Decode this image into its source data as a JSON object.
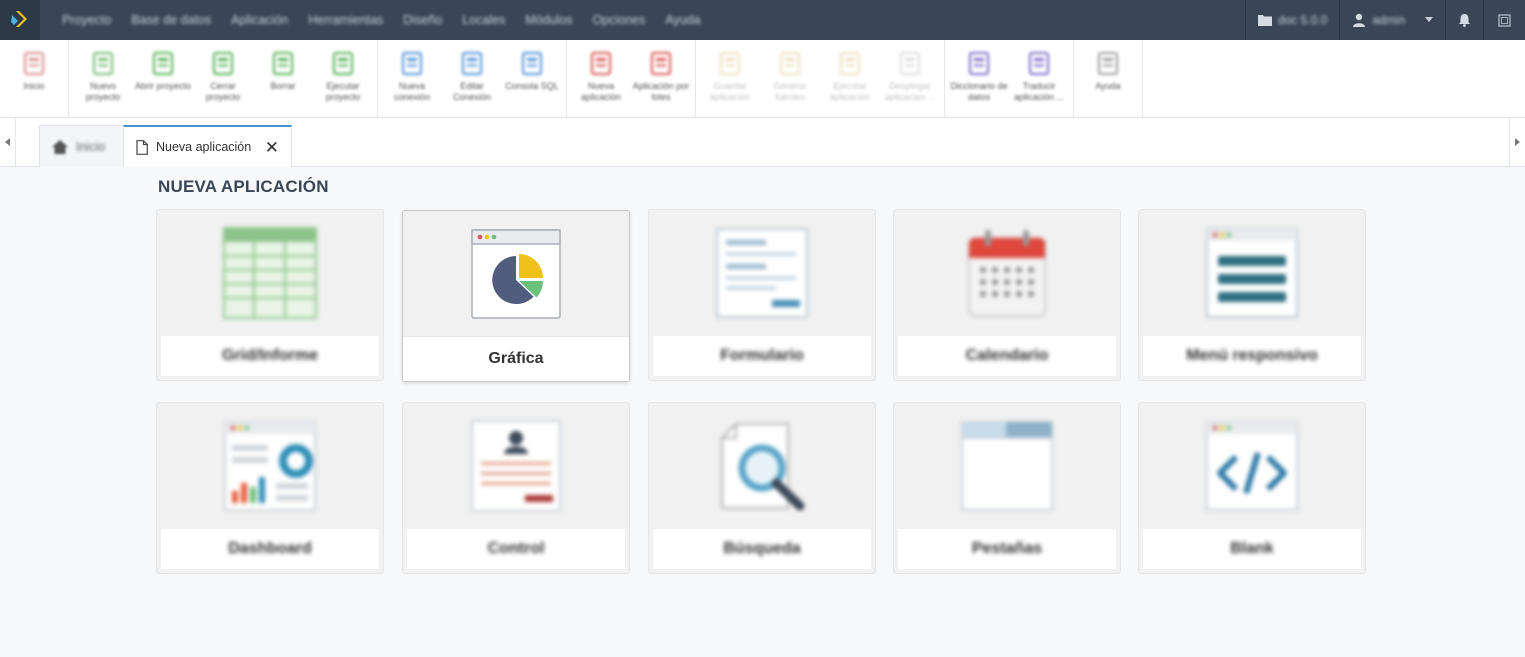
{
  "menubar": {
    "items": [
      "Proyecto",
      "Base de datos",
      "Aplicación",
      "Herramientas",
      "Diseño",
      "Locales",
      "Módulos",
      "Opciones",
      "Ayuda"
    ],
    "project": "doc 5.0.0",
    "user": "admin"
  },
  "toolbar": {
    "groups": [
      [
        {
          "label": "Inicio",
          "icon": "home-icon",
          "color": "#d98a8a"
        }
      ],
      [
        {
          "label": "Nuevo proyecto",
          "icon": "new-project-icon",
          "color": "#6db86d"
        },
        {
          "label": "Abrir proyecto",
          "icon": "open-project-icon",
          "color": "#4fae4f"
        },
        {
          "label": "Cerrar proyecto",
          "icon": "close-project-icon",
          "color": "#4fae4f"
        },
        {
          "label": "Borrar",
          "icon": "delete-icon",
          "color": "#4fae4f"
        },
        {
          "label": "Ejecutar proyecto",
          "icon": "run-project-icon",
          "color": "#4fae4f"
        }
      ],
      [
        {
          "label": "Nueva conexión",
          "icon": "new-connection-icon",
          "color": "#4a90d9"
        },
        {
          "label": "Editar Conexión",
          "icon": "edit-connection-icon",
          "color": "#4a90d9"
        },
        {
          "label": "Consola SQL",
          "icon": "sql-console-icon",
          "color": "#4a90d9"
        }
      ],
      [
        {
          "label": "Nueva aplicación",
          "icon": "new-app-icon",
          "color": "#d9534f"
        },
        {
          "label": "Aplicación por lotes",
          "icon": "batch-app-icon",
          "color": "#d9534f"
        }
      ],
      [
        {
          "label": "Guardar aplicación",
          "icon": "save-app-icon",
          "color": "#c9a640",
          "disabled": true
        },
        {
          "label": "Generar fuentes",
          "icon": "generate-source-icon",
          "color": "#c9a640",
          "disabled": true
        },
        {
          "label": "Ejecutar aplicación",
          "icon": "run-app-icon",
          "color": "#c9a640",
          "disabled": true
        },
        {
          "label": "Desplegar aplicación ...",
          "icon": "deploy-app-icon",
          "color": "#999999",
          "disabled": true
        }
      ],
      [
        {
          "label": "Diccionario de datos",
          "icon": "data-dictionary-icon",
          "color": "#7b68c8"
        },
        {
          "label": "Traducir aplicación ...",
          "icon": "translate-app-icon",
          "color": "#7b68c8"
        }
      ],
      [
        {
          "label": "Ayuda",
          "icon": "help-icon",
          "color": "#999999"
        }
      ]
    ]
  },
  "tabs": {
    "home_label": "Inicio",
    "active_label": "Nueva aplicación",
    "close_glyph": "✕"
  },
  "page": {
    "title": "NUEVA APLICACIÓN"
  },
  "cards": [
    {
      "label": "Grid/Informe",
      "icon": "grid-report-icon"
    },
    {
      "label": "Gráfica",
      "icon": "chart-icon",
      "selected": true
    },
    {
      "label": "Formulario",
      "icon": "form-icon"
    },
    {
      "label": "Calendario",
      "icon": "calendar-icon"
    },
    {
      "label": "Menú responsivo",
      "icon": "responsive-menu-icon"
    },
    {
      "label": "Dashboard",
      "icon": "dashboard-icon"
    },
    {
      "label": "Control",
      "icon": "control-icon"
    },
    {
      "label": "Búsqueda",
      "icon": "search-icon"
    },
    {
      "label": "Pestañas",
      "icon": "tabs-icon"
    },
    {
      "label": "Blank",
      "icon": "blank-code-icon"
    }
  ],
  "colors": {
    "menubar_bg": "#3a4656",
    "accent_blue": "#4a90c8",
    "chart_pie_dark": "#515c7f",
    "chart_pie_yellow": "#efc11a",
    "chart_pie_green": "#6bc07a"
  }
}
